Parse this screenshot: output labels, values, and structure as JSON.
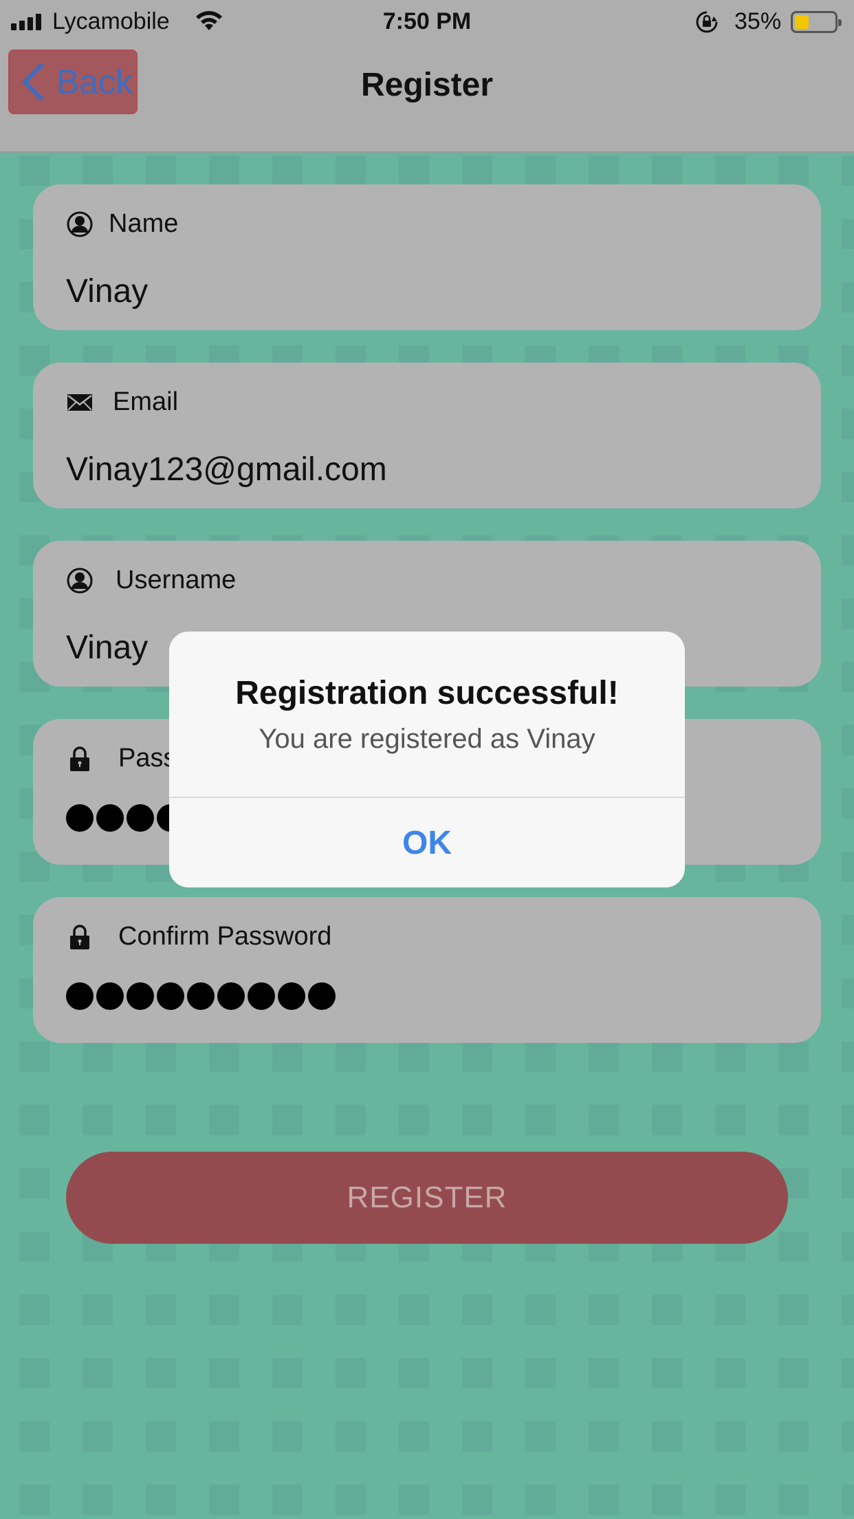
{
  "status_bar": {
    "carrier": "Lycamobile",
    "time": "7:50 PM",
    "battery_percent": "35%",
    "battery_level": 0.35,
    "icons": [
      "signal-icon",
      "wifi-icon",
      "rotation-lock-icon",
      "battery-icon"
    ]
  },
  "nav": {
    "back_label": "Back",
    "title": "Register"
  },
  "form": {
    "name": {
      "label": "Name",
      "value": "Vinay",
      "icon": "person-icon"
    },
    "email": {
      "label": "Email",
      "value": "Vinay123@gmail.com",
      "icon": "envelope-icon"
    },
    "username": {
      "label": "Username",
      "value": "Vinay",
      "icon": "person-icon"
    },
    "password": {
      "label": "Password",
      "label_visible": "Pass",
      "masked_length": 10,
      "icon": "lock-icon"
    },
    "confirm_password": {
      "label": "Confirm Password",
      "masked_length": 9,
      "icon": "lock-icon"
    },
    "register_label": "REGISTER"
  },
  "alert": {
    "title": "Registration successful!",
    "message": "You are registered as Vinay",
    "ok_label": "OK"
  },
  "colors": {
    "background": "#559a8a",
    "pattern": "#62ab99",
    "nav_bar": "#aeaeae",
    "field": "#b3b3b3",
    "back_button": "#a3585d",
    "register_button": "#944b4f",
    "alert_ok": "#3f85e8",
    "battery_fill": "#f2c600"
  }
}
